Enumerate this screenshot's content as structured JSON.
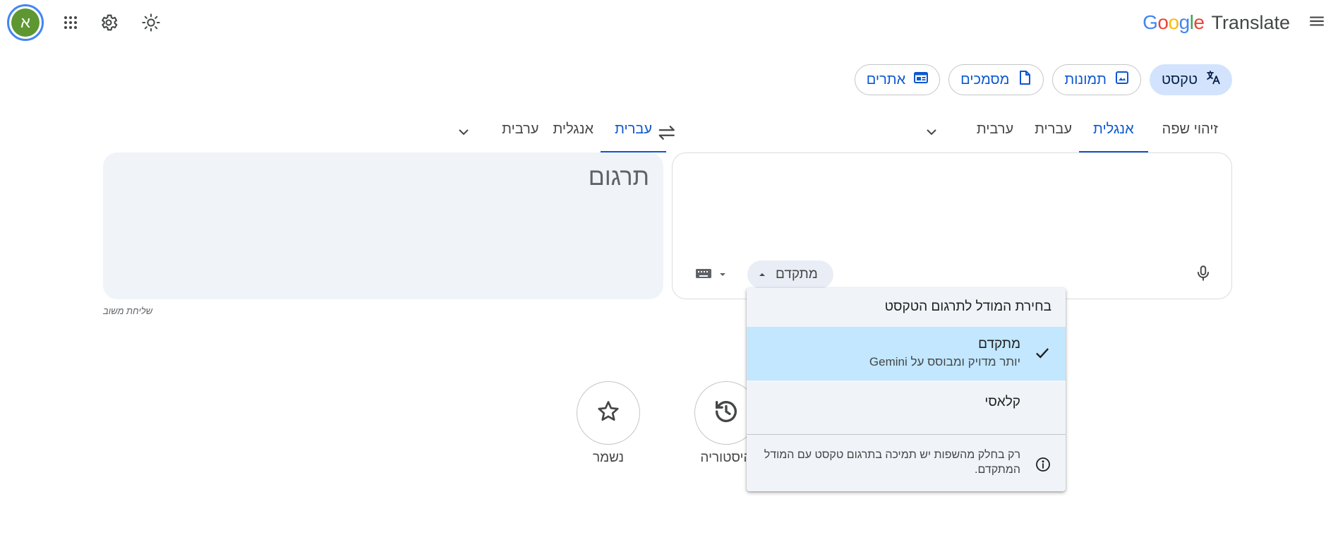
{
  "header": {
    "logo_google": [
      "G",
      "o",
      "o",
      "g",
      "l",
      "e"
    ],
    "logo_colors": [
      "#4285f4",
      "#ea4335",
      "#fbbc04",
      "#4285f4",
      "#34a853",
      "#ea4335"
    ],
    "product": "Translate",
    "avatar_letter": "א",
    "icons": [
      "menu-icon",
      "apps-grid-icon",
      "settings-gear-icon",
      "theme-sun-icon"
    ]
  },
  "modes": [
    {
      "label": "טקסט",
      "icon": "translate-icon",
      "active": true
    },
    {
      "label": "תמונות",
      "icon": "image-icon",
      "active": false
    },
    {
      "label": "מסמכים",
      "icon": "document-icon",
      "active": false
    },
    {
      "label": "אתרים",
      "icon": "website-icon",
      "active": false
    }
  ],
  "source_langs": [
    {
      "label": "זיהוי שפה",
      "active": false
    },
    {
      "label": "אנגלית",
      "active": true
    },
    {
      "label": "עברית",
      "active": false
    },
    {
      "label": "ערבית",
      "active": false
    }
  ],
  "target_langs": [
    {
      "label": "עברית",
      "active": true
    },
    {
      "label": "אנגלית",
      "active": false
    },
    {
      "label": "ערבית",
      "active": false
    }
  ],
  "translation_placeholder": "תרגום",
  "model_button": "מתקדם",
  "feedback": "שליחת משוב",
  "dropdown": {
    "title": "בחירת המודל לתרגום הטקסט",
    "options": [
      {
        "name": "מתקדם",
        "desc": "יותר מדויק ומבוסס על Gemini",
        "selected": true
      },
      {
        "name": "קלאסי",
        "desc": "",
        "selected": false
      }
    ],
    "info": "רק בחלק מהשפות יש תמיכה בתרגום טקסט עם המודל המתקדם."
  },
  "bottom": {
    "history_label": "היסטוריה",
    "saved_label": "נשמר"
  },
  "colors": {
    "accent": "#0b57d0",
    "chip_active_bg": "#d3e3fd",
    "selected_option_bg": "#c2e7ff",
    "panel_bg": "#f0f4f9",
    "avatar_bg": "#5e9732"
  }
}
